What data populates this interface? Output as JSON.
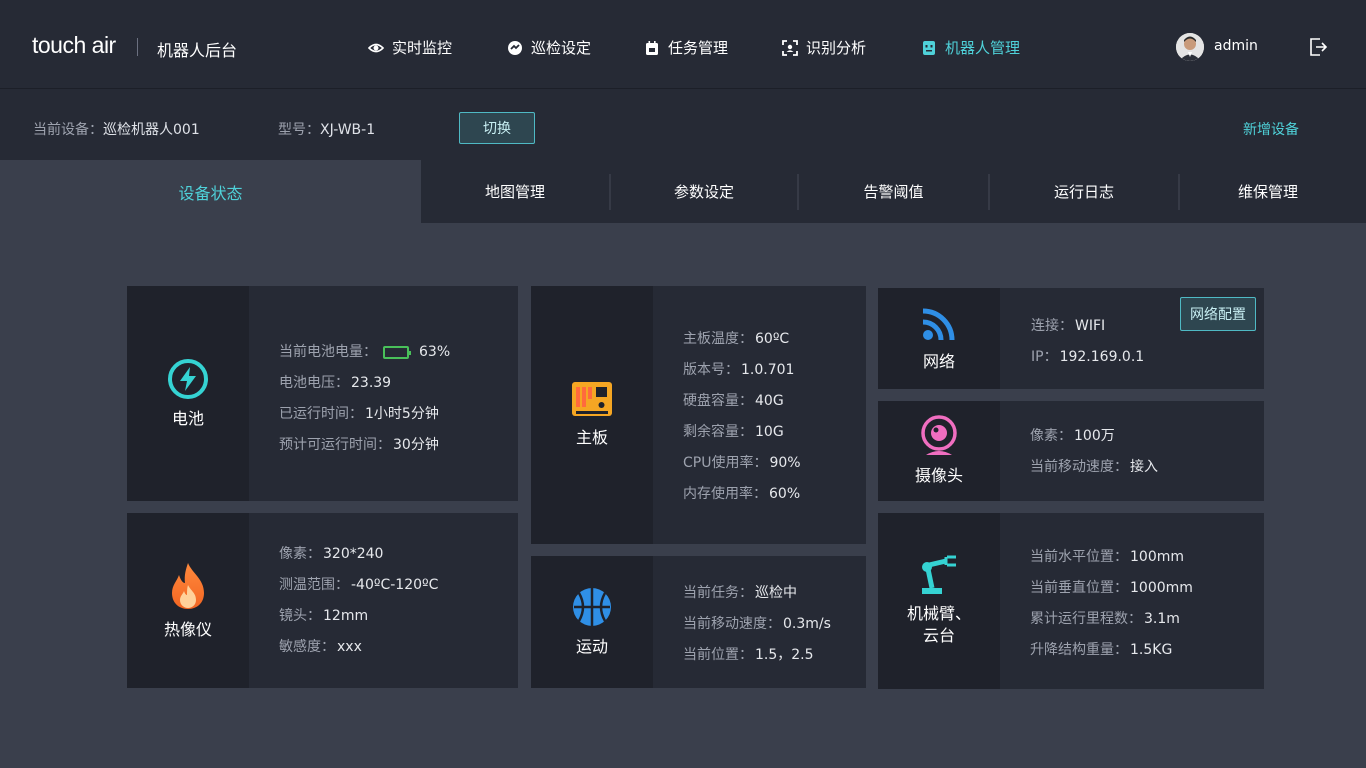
{
  "header": {
    "logo": "touch air",
    "app_title": "机器人后台",
    "nav": [
      {
        "label": "实时监控",
        "icon": "eye-icon"
      },
      {
        "label": "巡检设定",
        "icon": "patrol-icon"
      },
      {
        "label": "任务管理",
        "icon": "calendar-icon"
      },
      {
        "label": "识别分析",
        "icon": "face-scan-icon"
      },
      {
        "label": "机器人管理",
        "icon": "robot-icon",
        "active": true
      }
    ],
    "username": "admin"
  },
  "device_bar": {
    "current_label": "当前设备：",
    "current_value": "巡检机器人001",
    "model_label": "型号：",
    "model_value": "XJ-WB-1",
    "switch_label": "切换",
    "add_label": "新增设备"
  },
  "tabs": [
    "设备状态",
    "地图管理",
    "参数设定",
    "告警阈值",
    "运行日志",
    "维保管理"
  ],
  "battery_card": {
    "title": "电池",
    "level_label": "当前电池电量：",
    "level_value": "63%",
    "level_fraction": 0.63,
    "rows": [
      {
        "label": "电池电压：",
        "value": "23.39"
      },
      {
        "label": "已运行时间：",
        "value": "1小时5分钟"
      },
      {
        "label": "预计可运行时间：",
        "value": "30分钟"
      }
    ]
  },
  "thermal_card": {
    "title": "热像仪",
    "rows": [
      {
        "label": "像素：",
        "value": "320*240"
      },
      {
        "label": "测温范围：",
        "value": "-40ºC-120ºC"
      },
      {
        "label": "镜头：",
        "value": "12mm"
      },
      {
        "label": "敏感度：",
        "value": "xxx"
      }
    ]
  },
  "board_card": {
    "title": "主板",
    "rows": [
      {
        "label": "主板温度：",
        "value": "60ºC"
      },
      {
        "label": "版本号：",
        "value": "1.0.701"
      },
      {
        "label": "硬盘容量：",
        "value": "40G"
      },
      {
        "label": "剩余容量：",
        "value": "10G"
      },
      {
        "label": "CPU使用率：",
        "value": "90%"
      },
      {
        "label": "内存使用率：",
        "value": "60%"
      }
    ]
  },
  "motion_card": {
    "title": "运动",
    "rows": [
      {
        "label": "当前任务：",
        "value": "巡检中"
      },
      {
        "label": "当前移动速度：",
        "value": "0.3m/s"
      },
      {
        "label": "当前位置：",
        "value": "1.5，2.5"
      }
    ]
  },
  "network_card": {
    "title": "网络",
    "config_label": "网络配置",
    "rows": [
      {
        "label": "连接：",
        "value": "WIFI"
      },
      {
        "label": "IP：",
        "value": "192.169.0.1"
      }
    ]
  },
  "camera_card": {
    "title": "摄像头",
    "rows": [
      {
        "label": "像素：",
        "value": "100万"
      },
      {
        "label": "当前移动速度：",
        "value": "接入"
      }
    ]
  },
  "arm_card": {
    "title_line1": "机械臂、",
    "title_line2": "云台",
    "rows": [
      {
        "label": "当前水平位置：",
        "value": "100mm"
      },
      {
        "label": "当前垂直位置：",
        "value": "1000mm"
      },
      {
        "label": "累计运行里程数：",
        "value": "3.1m"
      },
      {
        "label": "升降结构重量：",
        "value": "1.5KG"
      }
    ]
  },
  "colors": {
    "accent": "#4fd1d9",
    "battery": "#49c05a",
    "background": "#3a3f4c",
    "panel": "#262a35"
  }
}
